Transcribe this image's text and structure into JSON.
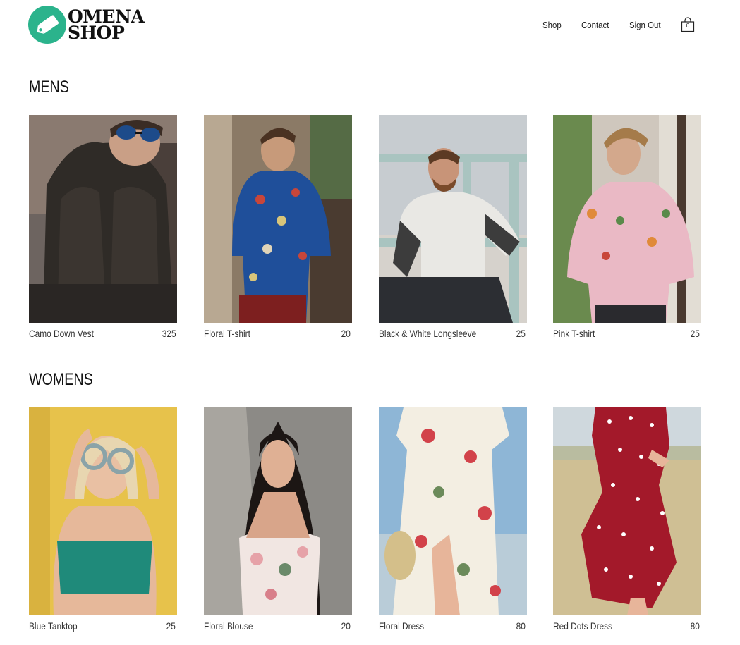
{
  "brand": {
    "line1": "OMENA",
    "line2": "SHOP"
  },
  "nav": {
    "shop": "Shop",
    "contact": "Contact",
    "sign_out": "Sign Out",
    "cart_count": "0"
  },
  "sections": {
    "mens": {
      "title": "MENS",
      "items": [
        {
          "name": "Camo Down Vest",
          "price": "325"
        },
        {
          "name": "Floral T-shirt",
          "price": "20"
        },
        {
          "name": "Black & White Longsleeve",
          "price": "25"
        },
        {
          "name": "Pink T-shirt",
          "price": "25"
        }
      ]
    },
    "womens": {
      "title": "WOMENS",
      "items": [
        {
          "name": "Blue Tanktop",
          "price": "25"
        },
        {
          "name": "Floral Blouse",
          "price": "20"
        },
        {
          "name": "Floral Dress",
          "price": "80"
        },
        {
          "name": "Red Dots Dress",
          "price": "80"
        }
      ]
    }
  },
  "colors": {
    "brand_green": "#2bb38c",
    "text": "#222222"
  }
}
